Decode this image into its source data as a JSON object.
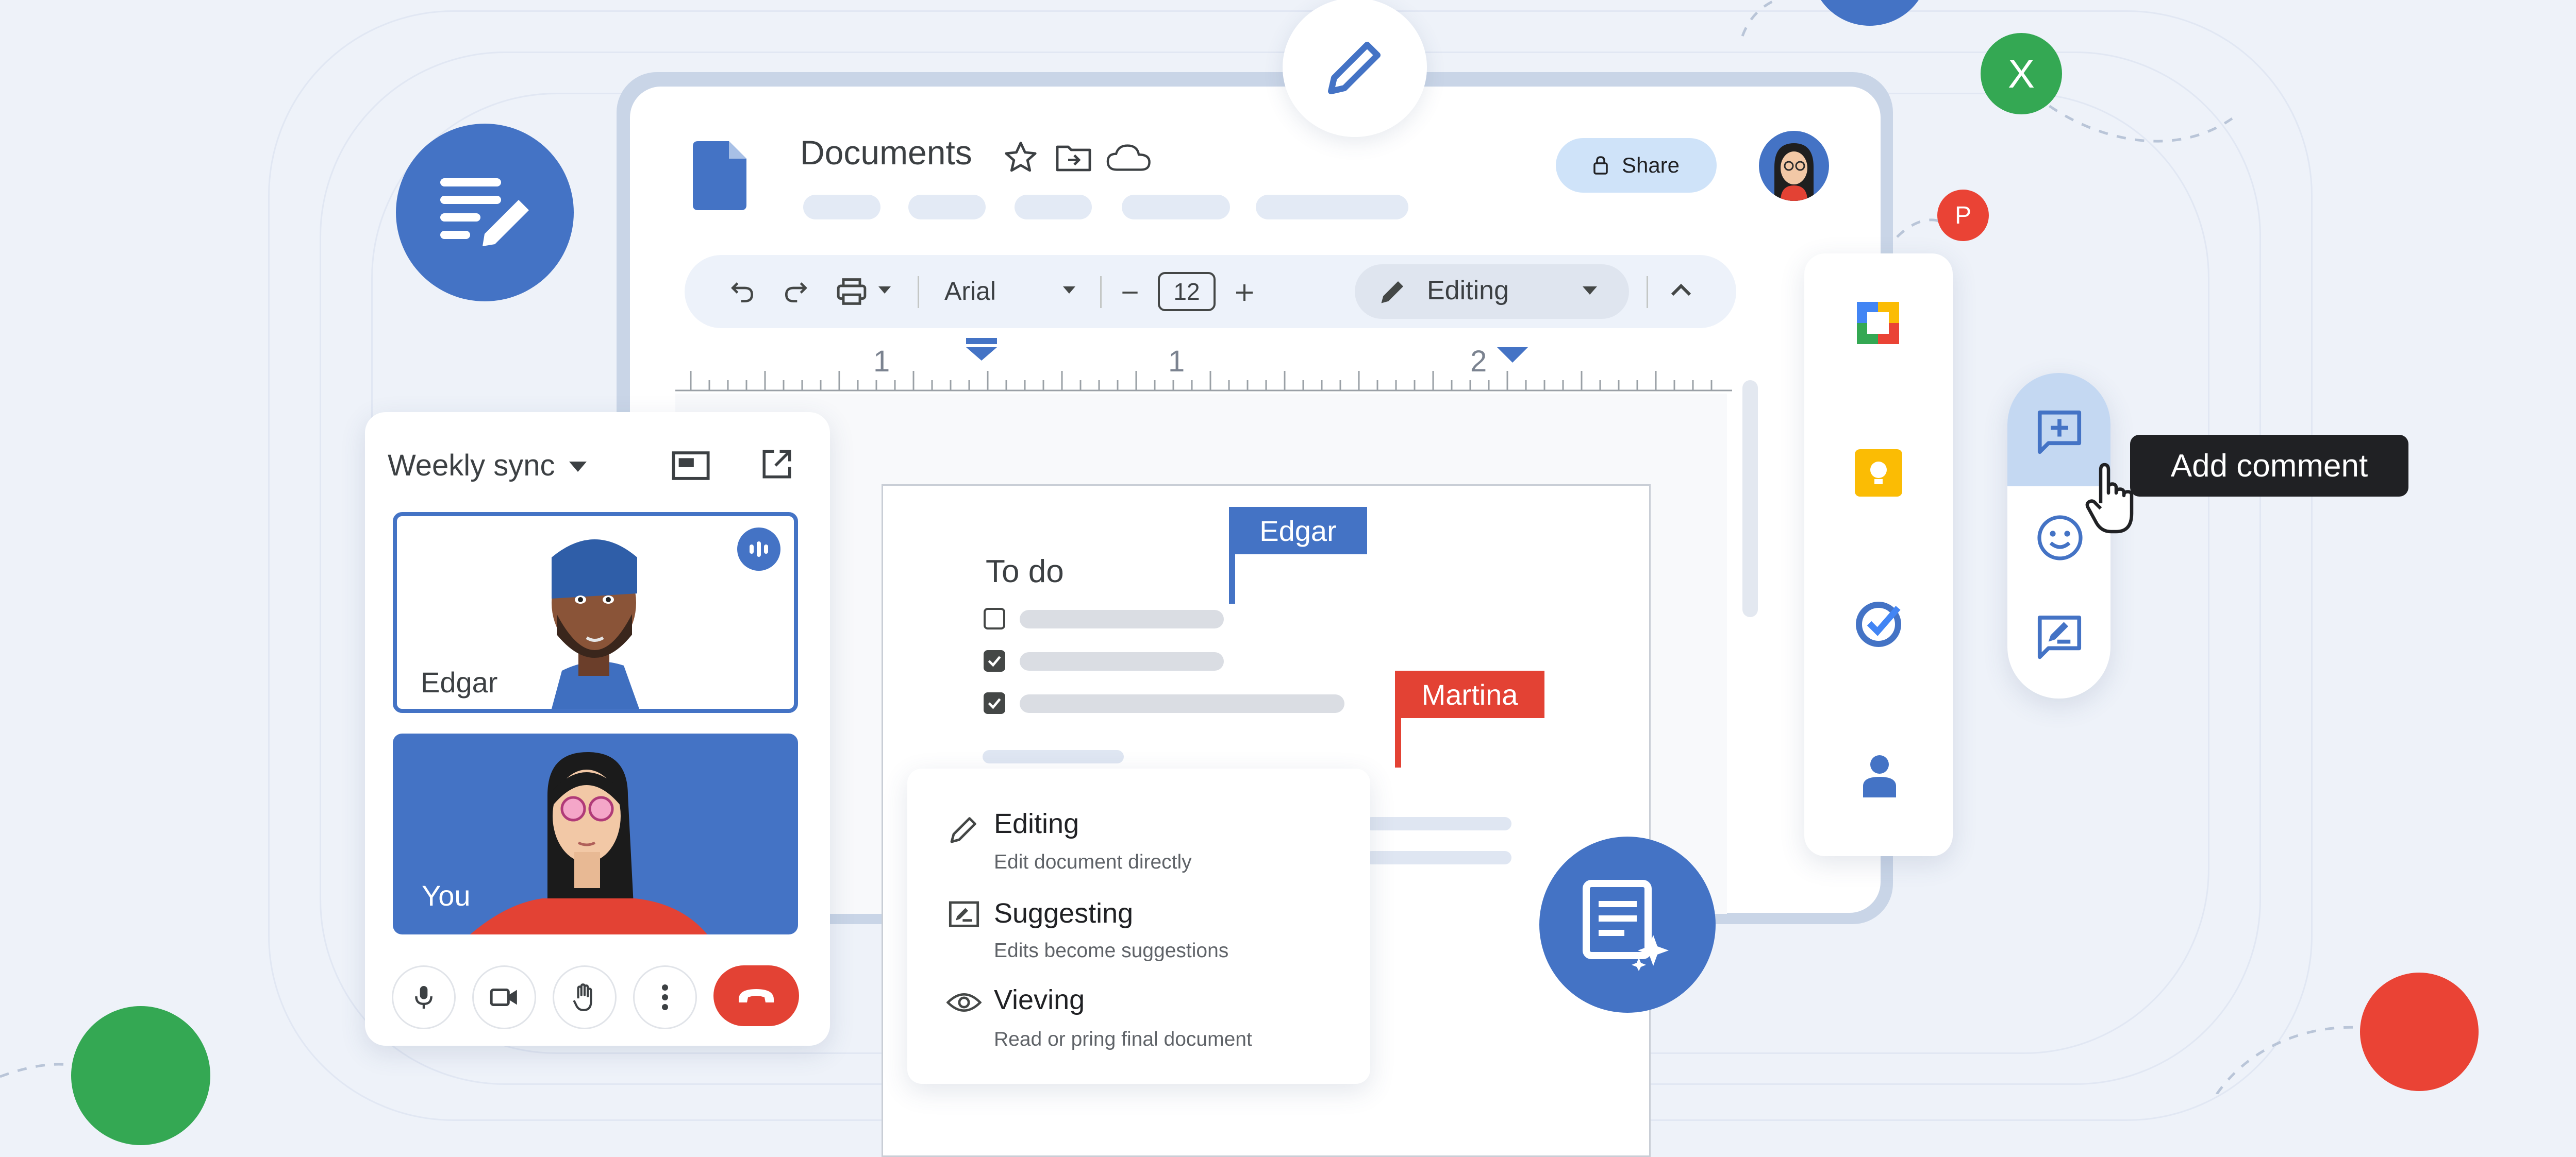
{
  "doc": {
    "title": "Documents",
    "share_label": "Share",
    "font_name": "Arial",
    "font_size": "12",
    "mode_label": "Editing",
    "ruler_labels": [
      "1",
      "1",
      "2"
    ]
  },
  "page": {
    "heading": "To do",
    "checklist": [
      false,
      true,
      true
    ]
  },
  "cursors": [
    {
      "name": "Edgar",
      "color": "#4473c5"
    },
    {
      "name": "Martina",
      "color": "#e34234"
    }
  ],
  "meet": {
    "title": "Weekly sync",
    "participants": [
      {
        "name": "Edgar",
        "speaking": true
      },
      {
        "name": "You",
        "speaking": false
      }
    ]
  },
  "mode_menu": [
    {
      "title": "Editing",
      "subtitle": "Edit document directly",
      "icon": "pencil-icon"
    },
    {
      "title": "Suggesting",
      "subtitle": "Edits become suggestions",
      "icon": "suggest-icon"
    },
    {
      "title": "Vieving",
      "subtitle": "Read or pring final document",
      "icon": "eye-icon"
    }
  ],
  "tooltip": "Add comment",
  "avatar_badges": {
    "x": "X",
    "p": "P"
  },
  "side_apps": [
    "calendar-icon",
    "keep-icon",
    "tasks-icon",
    "contacts-icon"
  ],
  "colors": {
    "brand_blue": "#4473c5",
    "green": "#34a853",
    "red": "#ea4335",
    "yellow": "#fbbc04",
    "light_blue": "#cfe3f9"
  }
}
